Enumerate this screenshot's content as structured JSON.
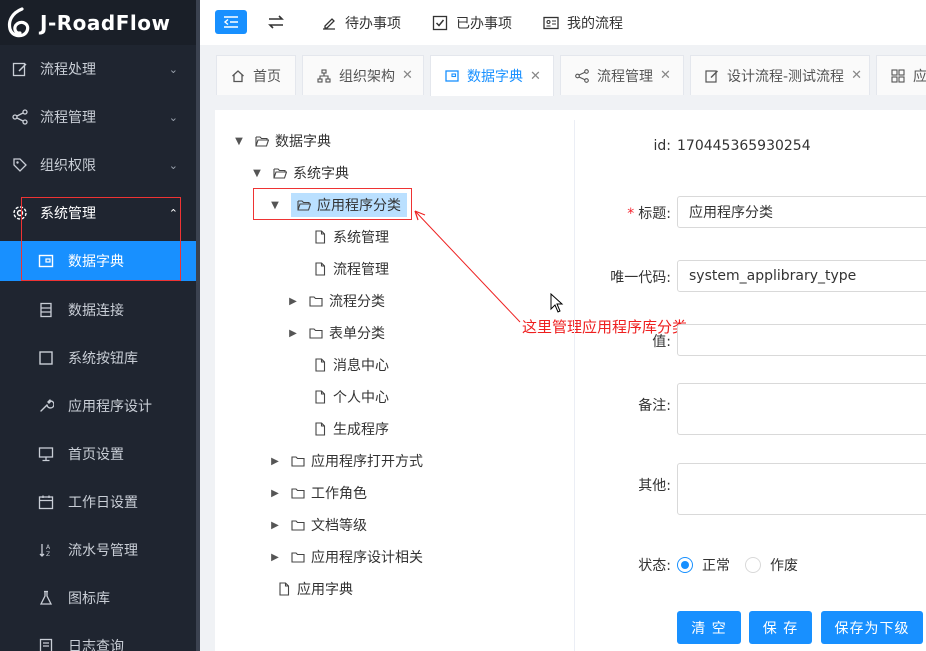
{
  "app": {
    "logo_text": "J-RoadFlow"
  },
  "sidebar": {
    "groups": [
      {
        "label": "流程处理",
        "icon": "edit-icon"
      },
      {
        "label": "流程管理",
        "icon": "share-icon"
      },
      {
        "label": "组织权限",
        "icon": "tag-icon"
      },
      {
        "label": "系统管理",
        "icon": "gear-icon"
      }
    ],
    "items": [
      {
        "label": "数据字典",
        "icon": "dictionary-icon"
      },
      {
        "label": "数据连接",
        "icon": "database-icon"
      },
      {
        "label": "系统按钮库",
        "icon": "square-icon"
      },
      {
        "label": "应用程序设计",
        "icon": "wrench-icon"
      },
      {
        "label": "首页设置",
        "icon": "monitor-icon"
      },
      {
        "label": "工作日设置",
        "icon": "calendar-icon"
      },
      {
        "label": "流水号管理",
        "icon": "sort-icon"
      },
      {
        "label": "图标库",
        "icon": "flask-icon"
      },
      {
        "label": "日志查询",
        "icon": "log-icon"
      }
    ]
  },
  "topbar": {
    "links": [
      "待办事项",
      "已办事项",
      "我的流程"
    ]
  },
  "tabs": [
    {
      "label": "首页",
      "closable": false
    },
    {
      "label": "组织架构",
      "closable": true
    },
    {
      "label": "数据字典",
      "closable": true
    },
    {
      "label": "流程管理",
      "closable": true
    },
    {
      "label": "设计流程-测试流程",
      "closable": true
    },
    {
      "label": "应",
      "closable": false
    }
  ],
  "tree": {
    "root": "数据字典",
    "system": "系统字典",
    "app_category": "应用程序分类",
    "children": [
      "系统管理",
      "流程管理",
      "流程分类",
      "表单分类",
      "消息中心",
      "个人中心",
      "生成程序"
    ],
    "siblings": [
      "应用程序打开方式",
      "工作角色",
      "文档等级",
      "应用程序设计相关"
    ],
    "app_dict": "应用字典"
  },
  "annotation": "这里管理应用程序库分类",
  "form": {
    "id_label": "id:",
    "id_value": "170445365930254",
    "title_label": "标题:",
    "title_value": "应用程序分类",
    "code_label": "唯一代码:",
    "code_value": "system_applibrary_type",
    "value_label": "值:",
    "remark_label": "备注:",
    "other_label": "其他:",
    "status_label": "状态:",
    "status_options": [
      "正常",
      "作废"
    ],
    "status_selected": "正常"
  },
  "buttons": {
    "clear": "清 空",
    "save": "保 存",
    "save_child": "保存为下级"
  },
  "colors": {
    "sidebar_bg": "#1f2530",
    "accent": "#1890ff",
    "annotation": "#ee1f1f"
  }
}
